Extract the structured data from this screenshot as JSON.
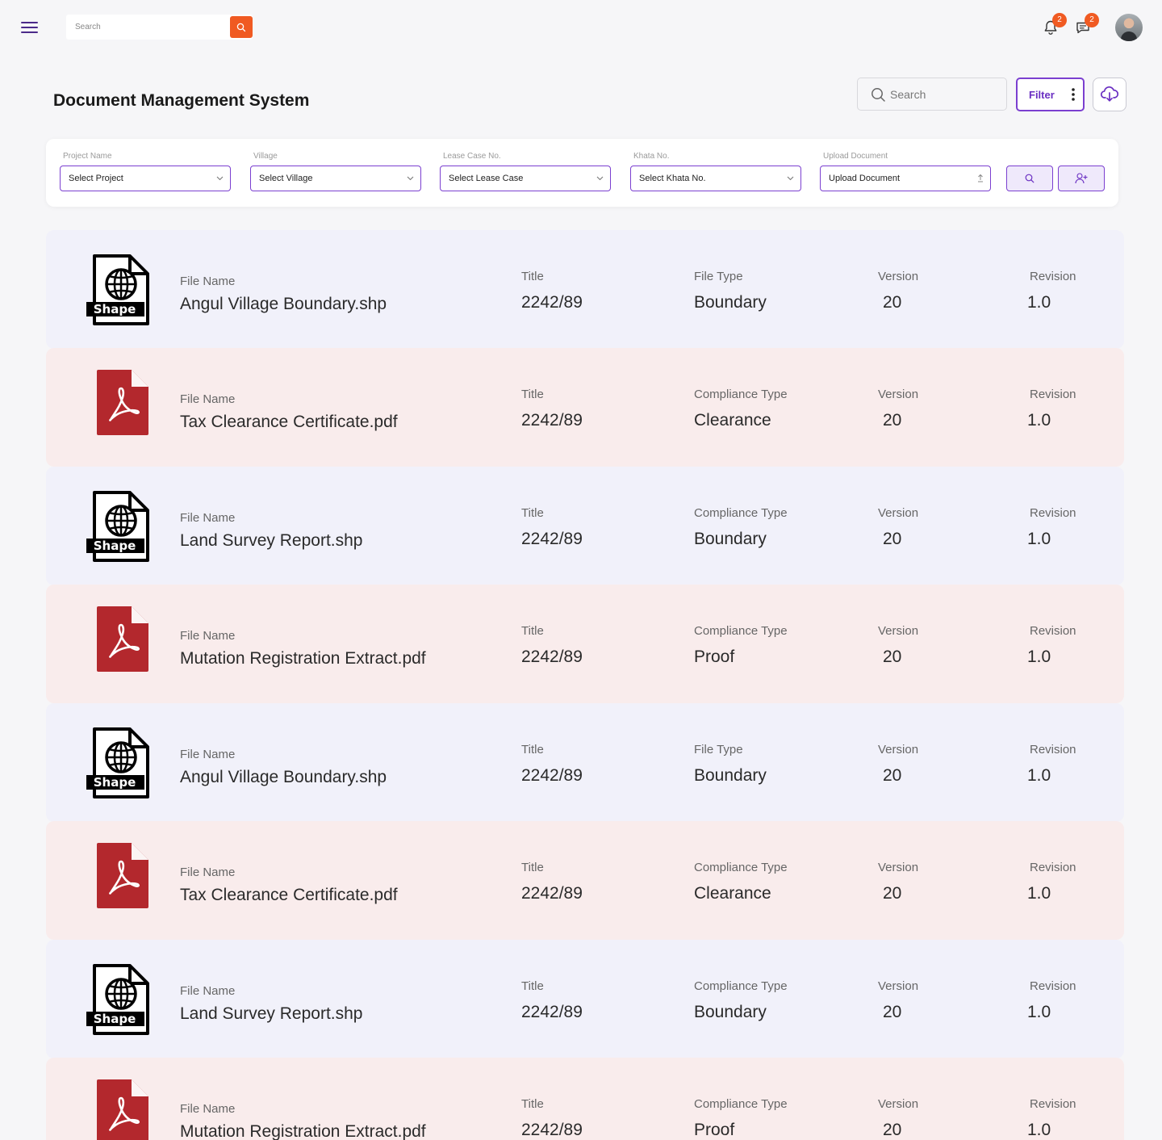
{
  "topbar": {
    "search_placeholder": "Search",
    "notification_count": "2",
    "message_count": "2"
  },
  "header": {
    "title": "Document Management System",
    "search_placeholder": "Search",
    "filter_label": "Filter"
  },
  "filters": {
    "project_label": "Project Name",
    "project_value": "Select Project",
    "village_label": "Village",
    "village_value": "Select Village",
    "lease_label": "Lease Case No.",
    "lease_value": "Select Lease Case",
    "khata_label": "Khata No.",
    "khata_value": "Select Khata No.",
    "upload_label": "Upload Document",
    "upload_value": "Upload Document"
  },
  "documents": [
    {
      "kind": "shape",
      "file_label": "File Name",
      "file_name": "Angul Village Boundary.shp",
      "title_label": "Title",
      "title": "2242/89",
      "type_label": "File Type",
      "type": "Boundary",
      "version_label": "Version",
      "version": "20",
      "revision_label": "Revision",
      "revision": "1.0"
    },
    {
      "kind": "pdf",
      "file_label": "File Name",
      "file_name": "Tax Clearance Certificate.pdf",
      "title_label": "Title",
      "title": "2242/89",
      "type_label": "Compliance Type",
      "type": "Clearance",
      "version_label": "Version",
      "version": "20",
      "revision_label": "Revision",
      "revision": "1.0"
    },
    {
      "kind": "shape",
      "file_label": "File Name",
      "file_name": "Land Survey Report.shp",
      "title_label": "Title",
      "title": "2242/89",
      "type_label": "Compliance Type",
      "type": "Boundary",
      "version_label": "Version",
      "version": "20",
      "revision_label": "Revision",
      "revision": "1.0"
    },
    {
      "kind": "pdf",
      "file_label": "File Name",
      "file_name": "Mutation Registration Extract.pdf",
      "title_label": "Title",
      "title": "2242/89",
      "type_label": "Compliance Type",
      "type": "Proof",
      "version_label": "Version",
      "version": "20",
      "revision_label": "Revision",
      "revision": "1.0"
    },
    {
      "kind": "shape",
      "file_label": "File Name",
      "file_name": "Angul Village Boundary.shp",
      "title_label": "Title",
      "title": "2242/89",
      "type_label": "File Type",
      "type": "Boundary",
      "version_label": "Version",
      "version": "20",
      "revision_label": "Revision",
      "revision": "1.0"
    },
    {
      "kind": "pdf",
      "file_label": "File Name",
      "file_name": "Tax Clearance Certificate.pdf",
      "title_label": "Title",
      "title": "2242/89",
      "type_label": "Compliance Type",
      "type": "Clearance",
      "version_label": "Version",
      "version": "20",
      "revision_label": "Revision",
      "revision": "1.0"
    },
    {
      "kind": "shape",
      "file_label": "File Name",
      "file_name": "Land Survey Report.shp",
      "title_label": "Title",
      "title": "2242/89",
      "type_label": "Compliance Type",
      "type": "Boundary",
      "version_label": "Version",
      "version": "20",
      "revision_label": "Revision",
      "revision": "1.0"
    },
    {
      "kind": "pdf",
      "file_label": "File Name",
      "file_name": "Mutation Registration Extract.pdf",
      "title_label": "Title",
      "title": "2242/89",
      "type_label": "Compliance Type",
      "type": "Proof",
      "version_label": "Version",
      "version": "20",
      "revision_label": "Revision",
      "revision": "1.0"
    }
  ],
  "icons": {
    "shape_label": "Shape",
    "menu": "hamburger-menu-icon",
    "search": "search-icon",
    "bell": "bell-icon",
    "message": "message-icon",
    "cloud": "cloud-download-icon",
    "add_user": "add-user-icon",
    "upload": "upload-icon"
  },
  "colors": {
    "accent": "#7b3fd0",
    "orange": "#f05a22",
    "pdf_red": "#b3282d",
    "row_blue": "#f1f1fa",
    "row_pink": "#f9ecec"
  }
}
